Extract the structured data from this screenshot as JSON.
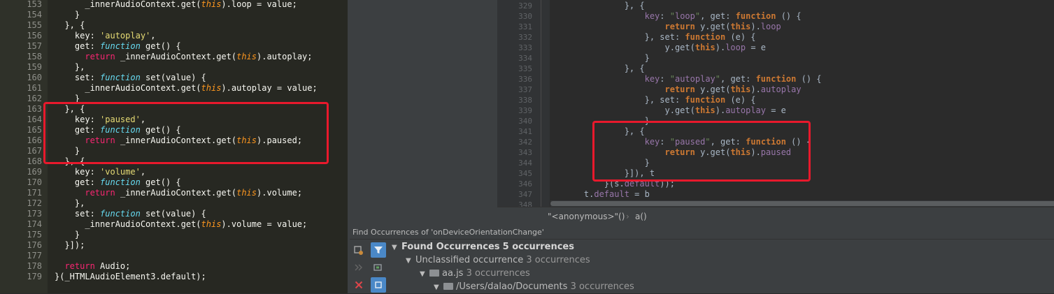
{
  "left_editor": {
    "lines": [
      {
        "n": "153",
        "t": "      _innerAudioContext.get(this).loop = value;"
      },
      {
        "n": "154",
        "t": "    }"
      },
      {
        "n": "155",
        "t": "  }, {"
      },
      {
        "n": "156",
        "t": "    key: 'autoplay',"
      },
      {
        "n": "157",
        "t": "    get: function get() {"
      },
      {
        "n": "158",
        "t": "      return _innerAudioContext.get(this).autoplay;"
      },
      {
        "n": "159",
        "t": "    },"
      },
      {
        "n": "160",
        "t": "    set: function set(value) {"
      },
      {
        "n": "161",
        "t": "      _innerAudioContext.get(this).autoplay = value;"
      },
      {
        "n": "162",
        "t": "    }"
      },
      {
        "n": "163",
        "t": "  }, {"
      },
      {
        "n": "164",
        "t": "    key: 'paused',"
      },
      {
        "n": "165",
        "t": "    get: function get() {"
      },
      {
        "n": "166",
        "t": "      return _innerAudioContext.get(this).paused;"
      },
      {
        "n": "167",
        "t": "    }"
      },
      {
        "n": "168",
        "t": "  }, {"
      },
      {
        "n": "169",
        "t": "    key: 'volume',"
      },
      {
        "n": "170",
        "t": "    get: function get() {"
      },
      {
        "n": "171",
        "t": "      return _innerAudioContext.get(this).volume;"
      },
      {
        "n": "172",
        "t": "    },"
      },
      {
        "n": "173",
        "t": "    set: function set(value) {"
      },
      {
        "n": "174",
        "t": "      _innerAudioContext.get(this).volume = value;"
      },
      {
        "n": "175",
        "t": "    }"
      },
      {
        "n": "176",
        "t": "  }]);"
      },
      {
        "n": "177",
        "t": ""
      },
      {
        "n": "178",
        "t": "  return Audio;"
      },
      {
        "n": "179",
        "t": "}(_HTMLAudioElement3.default);"
      }
    ]
  },
  "right_editor": {
    "lines": [
      {
        "n": "329",
        "t": "            }, {"
      },
      {
        "n": "330",
        "t": "                key: \"loop\", get: function () {"
      },
      {
        "n": "331",
        "t": "                    return y.get(this).loop"
      },
      {
        "n": "332",
        "t": "                }, set: function (e) {"
      },
      {
        "n": "333",
        "t": "                    y.get(this).loop = e"
      },
      {
        "n": "334",
        "t": "                }"
      },
      {
        "n": "335",
        "t": "            }, {"
      },
      {
        "n": "336",
        "t": "                key: \"autoplay\", get: function () {"
      },
      {
        "n": "337",
        "t": "                    return y.get(this).autoplay"
      },
      {
        "n": "338",
        "t": "                }, set: function (e) {"
      },
      {
        "n": "339",
        "t": "                    y.get(this).autoplay = e"
      },
      {
        "n": "340",
        "t": "                }"
      },
      {
        "n": "341",
        "t": "            }, {"
      },
      {
        "n": "342",
        "t": "                key: \"paused\", get: function () {"
      },
      {
        "n": "343",
        "t": "                    return y.get(this).paused"
      },
      {
        "n": "344",
        "t": "                }"
      },
      {
        "n": "345",
        "t": "            }]), t"
      },
      {
        "n": "346",
        "t": "        }(s.default));"
      },
      {
        "n": "347",
        "t": "    t.default = b"
      },
      {
        "n": "348",
        "t": ""
      }
    ],
    "breadcrumb": [
      "\"<anonymous>\"()",
      "a()"
    ],
    "breadcrumb_sep": "›"
  },
  "find_panel": {
    "title": "Find Occurrences of 'onDeviceOrientationChange'",
    "rows": [
      {
        "label": "Found Occurrences",
        "count": "5 occurrences"
      },
      {
        "label": "Unclassified occurrence",
        "count": "3 occurrences"
      },
      {
        "label": "aa.js",
        "count": "3 occurrences"
      },
      {
        "label": "/Users/dalao/Documents",
        "count": "3 occurrences"
      }
    ],
    "colors": {
      "accent": "#4a88c7",
      "close": "#e0454a"
    }
  }
}
